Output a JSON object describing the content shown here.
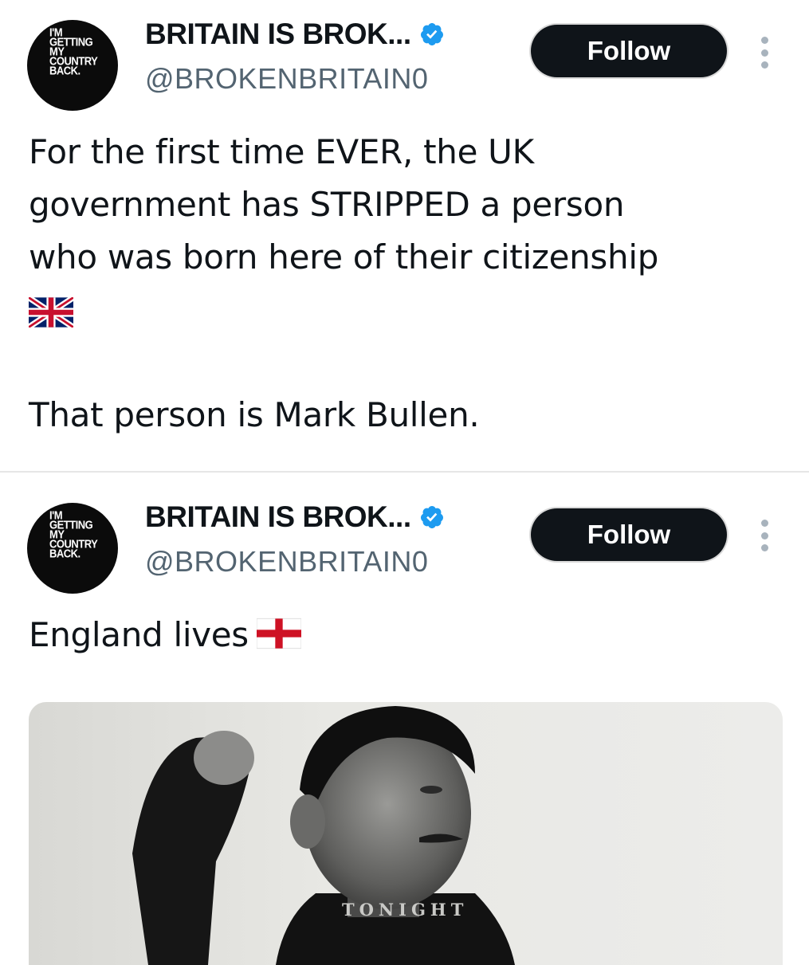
{
  "tweets": [
    {
      "avatar_logo_lines": [
        "I'M",
        "GETTING",
        "MY",
        "COUNTRY",
        "BACK."
      ],
      "display_name": "BRITAIN IS BROK...",
      "handle": "@BROKENBRITAIN0",
      "follow_label": "Follow",
      "text_lines": [
        "For the first time EVER, the UK",
        "government has STRIPPED a person",
        "who was born here of their citizenship"
      ],
      "text_emoji": "flag-united-kingdom-icon",
      "text_line_2": "That person is Mark Bullen."
    },
    {
      "avatar_logo_lines": [
        "I'M",
        "GETTING",
        "MY",
        "COUNTRY",
        "BACK."
      ],
      "display_name": "BRITAIN IS BROK...",
      "handle": "@BROKENBRITAIN0",
      "follow_label": "Follow",
      "text": "England lives",
      "text_emoji": "flag-england-icon",
      "media_caption": "TONIGHT"
    }
  ],
  "colors": {
    "verified_badge": "#1d9bf0",
    "follow_button": "#0f1419",
    "handle": "#536471"
  }
}
